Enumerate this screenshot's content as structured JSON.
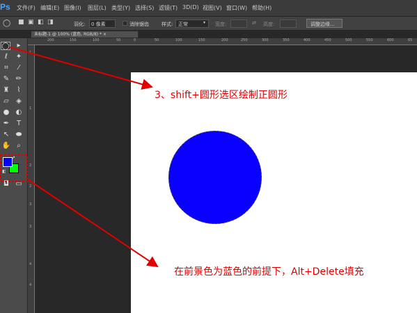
{
  "app": {
    "logo": "Ps"
  },
  "menu": [
    "文件(F)",
    "编辑(E)",
    "图像(I)",
    "图层(L)",
    "类型(Y)",
    "选择(S)",
    "滤镜(T)",
    "3D(D)",
    "视图(V)",
    "窗口(W)",
    "帮助(H)"
  ],
  "options": {
    "feather_label": "羽化:",
    "feather_value": "0 像素",
    "antialias_label": "消除锯齿",
    "style_label": "样式:",
    "style_value": "正常",
    "width_label": "宽度:",
    "height_label": "高度:",
    "refine_edge": "调整边缘..."
  },
  "document_tab": "未标题-1 @ 100% (蓝色, RGB/8) * ×",
  "ruler_h": [
    "200",
    "150",
    "100",
    "50",
    "0",
    "50",
    "100",
    "150",
    "200",
    "250",
    "300",
    "350",
    "400",
    "450",
    "500",
    "550",
    "600",
    "65"
  ],
  "ruler_v": [
    "1",
    "1",
    "2",
    "2",
    "3",
    "3",
    "4",
    "4"
  ],
  "annotations": {
    "step3": "3、shift+圆形选区绘制正圆形",
    "fill": "在前景色为蓝色的前提下，Alt+Delete填充"
  },
  "colors": {
    "foreground": "#0000ff",
    "background": "#00ff00",
    "circle": "#0a00ff",
    "annotation": "#e00000"
  }
}
